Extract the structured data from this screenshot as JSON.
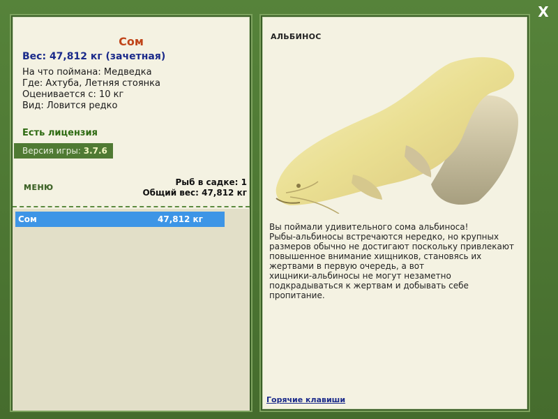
{
  "close_label": "X",
  "fish": {
    "name": "Сом",
    "weight_line": "Вес: 47,812 кг (зачетная)",
    "info": [
      "На что поймана: Медведка",
      "Где: Ахтуба, Летняя стоянка",
      "Оценивается с: 10 кг",
      "Вид: Ловится редко"
    ]
  },
  "license": "Есть лицензия",
  "version": {
    "label": "Версия игры: ",
    "value": "3.7.6"
  },
  "menu_label": "МЕНЮ",
  "keeper": {
    "count": "Рыб в садке: 1",
    "total": "Общий вес: 47,812 кг"
  },
  "catch_list": [
    {
      "name": "Сом",
      "weight": "47,812 кг"
    }
  ],
  "albino": {
    "title": "АЛЬБИНОС",
    "description": "Вы поймали удивительного сома альбиноса!\nРыбы-альбиносы встречаются нередко, но крупных\nразмеров обычно не достигают поскольку привлекают\nповышенное внимание хищников, становясь их\nжертвами в первую очередь, а вот\nхищники-альбиносы не могут незаметно\nподкрадываться к жертвам и добывать себе\nпропитание."
  },
  "hotkeys_label": "Горячие клавиши",
  "colors": {
    "frame": "#4a7530",
    "panel": "#f4f2e2",
    "accent_red": "#c0451a",
    "accent_blue": "#1a2a8a",
    "selection": "#3d95e6",
    "license_green": "#2e6b12"
  }
}
